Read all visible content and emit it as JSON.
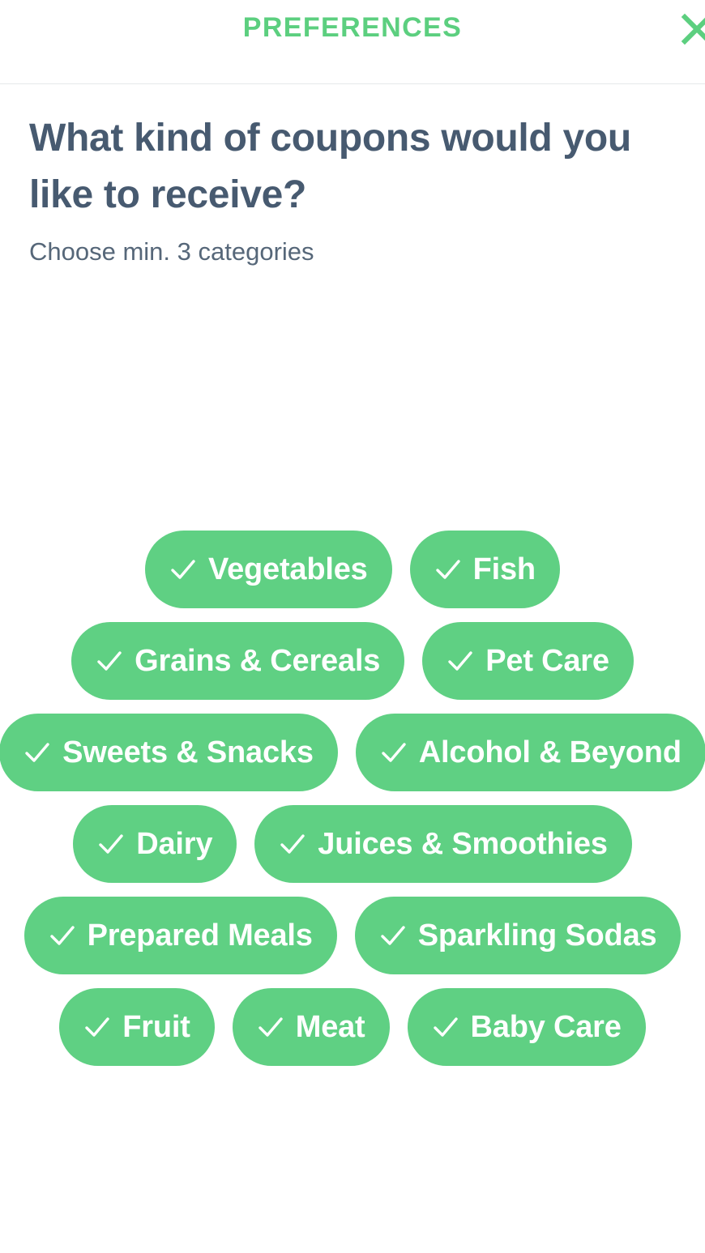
{
  "header": {
    "title": "PREFERENCES",
    "close_icon": "close-x-icon",
    "accent_color": "#5ccf7f"
  },
  "intro": {
    "question": "What kind of coupons would you like to receive?",
    "subtitle": "Choose min. 3 categories",
    "title_color": "#475a70"
  },
  "chips": {
    "check_icon": "checkmark-icon",
    "selected_color": "#5fd083",
    "label_color": "#ffffff",
    "rows": [
      [
        {
          "label": "Vegetables",
          "selected": true
        },
        {
          "label": "Fish",
          "selected": true
        }
      ],
      [
        {
          "label": "Grains & Cereals",
          "selected": true
        },
        {
          "label": "Pet Care",
          "selected": true
        }
      ],
      [
        {
          "label": "Sweets & Snacks",
          "selected": true
        },
        {
          "label": "Alcohol & Beyond",
          "selected": true
        }
      ],
      [
        {
          "label": "Dairy",
          "selected": true
        },
        {
          "label": "Juices & Smoothies",
          "selected": true
        }
      ],
      [
        {
          "label": "Prepared Meals",
          "selected": true
        },
        {
          "label": "Sparkling Sodas",
          "selected": true
        }
      ],
      [
        {
          "label": "Fruit",
          "selected": true
        },
        {
          "label": "Meat",
          "selected": true
        },
        {
          "label": "Baby Care",
          "selected": true
        }
      ]
    ]
  }
}
